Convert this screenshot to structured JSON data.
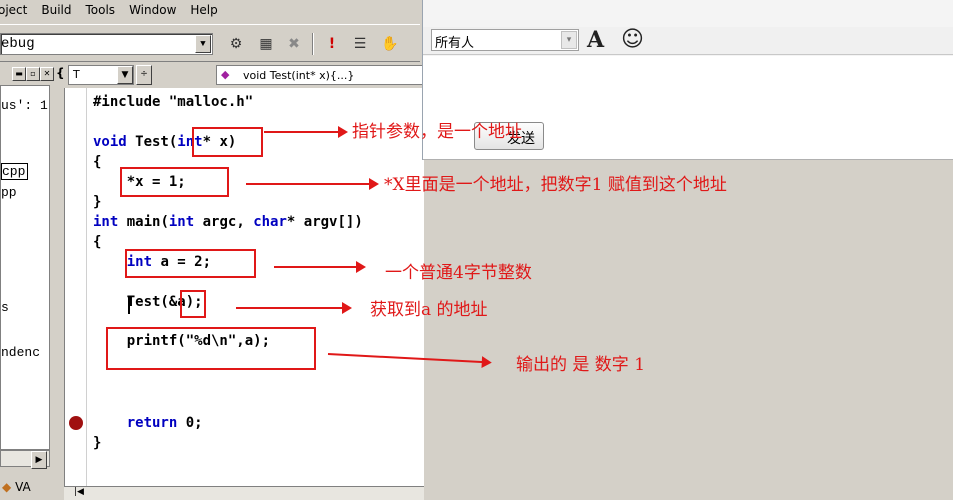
{
  "menu": [
    "oject",
    "Build",
    "Tools",
    "Window",
    "Help"
  ],
  "toolbar": {
    "config_value": "ebug",
    "icons": [
      "compile-icon",
      "build-icon",
      "stop-build-icon",
      "execute-icon",
      "go-icon",
      "hand-icon"
    ]
  },
  "left_pane": {
    "tree_items": [
      "us': 1",
      "cpp",
      "pp",
      "s",
      "ndenc"
    ],
    "tab_label": "VA"
  },
  "editor": {
    "class_combo": "T",
    "member_combo": "void Test(int* x){...}",
    "lines": {
      "l1": "#include \"malloc.h\"",
      "l2_kw1": "void",
      "l2_rest": " Test(",
      "l2_kw2": "int",
      "l2_tail": "* x)",
      "l3": "{",
      "l4": "    *x = 1;",
      "l5": "}",
      "l6_kw1": "int",
      "l6_mid": " main(",
      "l6_kw2": "int",
      "l6_mid2": " argc, ",
      "l6_kw3": "char",
      "l6_tail": "* argv[])",
      "l7": "{",
      "l8_ind": "    ",
      "l8_kw": "int",
      "l8_tail": " a = 2;",
      "l9": "    Test(&a);",
      "l10": "    printf(\"%d\\n\",a);",
      "l11_ind": "    ",
      "l11_kw": "return",
      "l11_tail": " 0;",
      "l12": "}"
    }
  },
  "chat": {
    "recipient": "所有人",
    "send_label": "发送"
  },
  "annotations": [
    "指针参数，是一个地址",
    "*X里面是一个地址，把数字1 赋值到这个地址",
    "一个普通4字节整数",
    "获取到a 的地址",
    "输出的 是 数字 1"
  ],
  "colors": {
    "annotation": "#e01818",
    "keyword": "#0000c0",
    "breakpoint": "#a01010"
  }
}
